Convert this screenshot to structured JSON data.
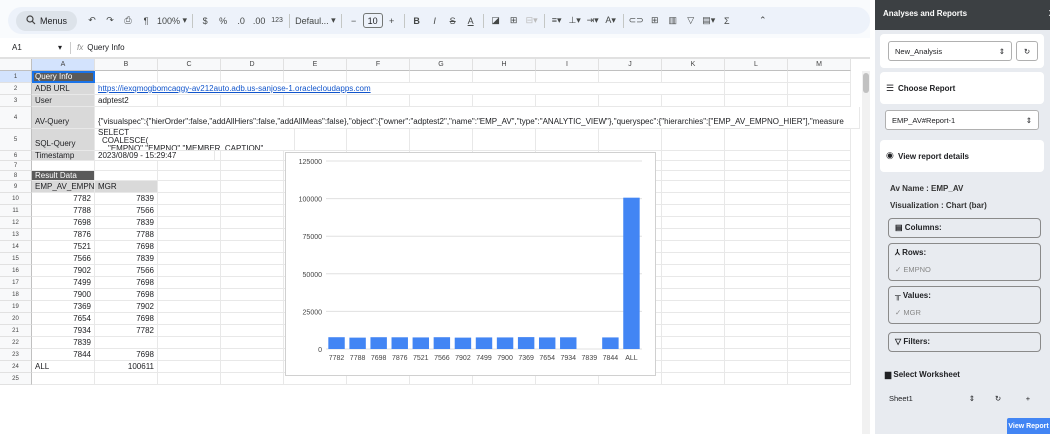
{
  "toolbar": {
    "menus_label": "Menus",
    "zoom": "100%",
    "currency": "$",
    "percent": "%",
    "dec_dec": ".0",
    "dec_inc": ".00",
    "format_123": "123",
    "font": "Defaul...",
    "minus": "−",
    "font_size": "10",
    "bold": "B",
    "italic": "I",
    "strike": "S",
    "text_color": "A"
  },
  "formula_bar": {
    "cell_ref": "A1",
    "fx": "fx",
    "content": "Query Info"
  },
  "columns": [
    "A",
    "B",
    "C",
    "D",
    "E",
    "F",
    "G",
    "H",
    "I",
    "J",
    "K",
    "L",
    "M"
  ],
  "rows": [
    "1",
    "2",
    "3",
    "4",
    "5",
    "6",
    "7",
    "8",
    "9",
    "10",
    "11",
    "12",
    "13",
    "14",
    "15",
    "16",
    "17",
    "18",
    "19",
    "20",
    "21",
    "22",
    "23",
    "24",
    "25"
  ],
  "sheet": {
    "query_info": "Query Info",
    "adb_url_label": "ADB URL",
    "adb_url": "https://iexqmogbomcaqgy-av212auto.adb.us-sanjose-1.oraclecloudapps.com",
    "user_label": "User",
    "user": "adptest2",
    "av_query_label": "AV-Query",
    "av_query": "{\"visualspec\":{\"hierOrder\":false,\"addAllHiers\":false,\"addAllMeas\":false},\"object\":{\"owner\":\"adptest2\",\"name\":\"EMP_AV\",\"type\":\"ANALYTIC_VIEW\"},\"queryspec\":{\"hierarchies\":[\"EMP_AV_EMPNO_HIER\"],\"measure",
    "sql_query_label": "SQL-Query",
    "sql_line1": "SELECT",
    "sql_line2": "COALESCE(",
    "sql_line3": "\"EMPNO\".\"EMPNO\".\"MEMBER_CAPTION\",",
    "timestamp_label": "Timestamp",
    "timestamp": "2023/08/09 - 15:29:47",
    "result_data": "Result Data",
    "col1": "EMP_AV_EMPNO",
    "col2": "MGR",
    "data": [
      [
        "7782",
        "7839"
      ],
      [
        "7788",
        "7566"
      ],
      [
        "7698",
        "7839"
      ],
      [
        "7876",
        "7788"
      ],
      [
        "7521",
        "7698"
      ],
      [
        "7566",
        "7839"
      ],
      [
        "7902",
        "7566"
      ],
      [
        "7499",
        "7698"
      ],
      [
        "7900",
        "7698"
      ],
      [
        "7369",
        "7902"
      ],
      [
        "7654",
        "7698"
      ],
      [
        "7934",
        "7782"
      ],
      [
        "7839",
        ""
      ],
      [
        "7844",
        "7698"
      ],
      [
        "ALL",
        "100611"
      ]
    ]
  },
  "chart_data": {
    "type": "bar",
    "categories": [
      "7782",
      "7788",
      "7698",
      "7876",
      "7521",
      "7566",
      "7902",
      "7499",
      "7900",
      "7369",
      "7654",
      "7934",
      "7839",
      "7844",
      "ALL"
    ],
    "values": [
      7839,
      7566,
      7839,
      7788,
      7698,
      7839,
      7566,
      7698,
      7698,
      7902,
      7698,
      7782,
      0,
      7698,
      100611
    ],
    "yticks": [
      "0",
      "25000",
      "50000",
      "75000",
      "100000",
      "125000"
    ],
    "ylim": [
      0,
      125000
    ],
    "bar_color": "#4285f4",
    "title": "",
    "xlabel": "",
    "ylabel": ""
  },
  "panel": {
    "title": "Analyses and Reports",
    "close": "X",
    "analysis": "New_Analysis",
    "choose_report": "Choose Report",
    "report": "EMP_AV#Report-1",
    "view_details": "View report details",
    "av_name": "Av Name : EMP_AV",
    "visualization": "Visualization : Chart (bar)",
    "columns_label": "Columns:",
    "rows_label": "Rows:",
    "rows_value": "✓ EMPNO",
    "values_label": "Values:",
    "values_value": "✓ MGR",
    "filters_label": "Filters:",
    "select_worksheet": "Select Worksheet",
    "worksheet": "Sheet1",
    "plus": "+",
    "view_report": "View Report"
  }
}
